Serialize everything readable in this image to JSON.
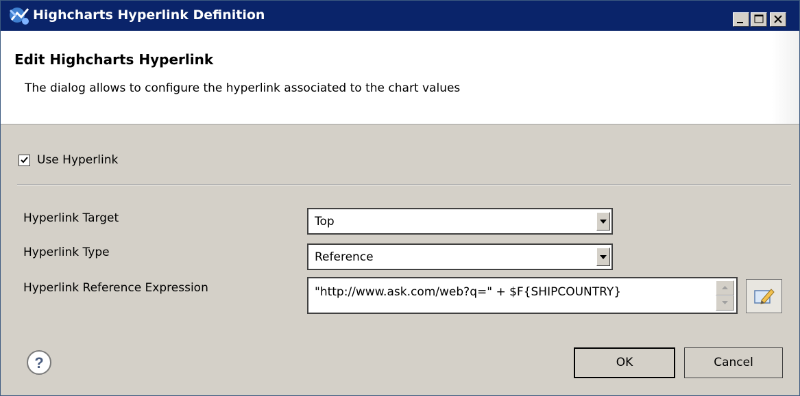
{
  "window": {
    "title": "Highcharts Hyperlink Definition",
    "app_icon": "highcharts-icon",
    "controls": [
      "minimize-icon",
      "maximize-icon",
      "close-icon"
    ]
  },
  "header": {
    "title": "Edit Highcharts Hyperlink",
    "description": "The dialog allows to configure the hyperlink associated to the chart values"
  },
  "use_hyperlink": {
    "label": "Use Hyperlink",
    "checked": true
  },
  "fields": {
    "target": {
      "label": "Hyperlink Target",
      "value": "Top"
    },
    "type": {
      "label": "Hyperlink Type",
      "value": "Reference"
    },
    "expression": {
      "label": "Hyperlink Reference Expression",
      "value": "\"http://www.ask.com/web?q=\" + $F{SHIPCOUNTRY}"
    }
  },
  "buttons": {
    "help": "?",
    "ok": "OK",
    "cancel": "Cancel"
  },
  "colors": {
    "titlebar": "#0a246a",
    "dialog_bg": "#d4d0c8",
    "header_bg": "#ffffff"
  }
}
